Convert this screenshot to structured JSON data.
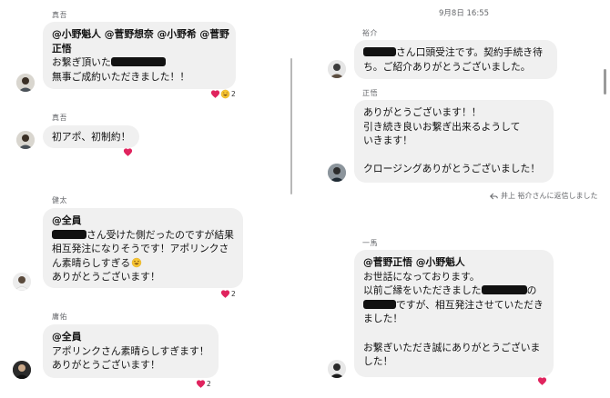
{
  "left": {
    "m1": {
      "sender": "真吾",
      "lines": [
        "@小野魁人 @菅野想奈 @小野希 @菅野",
        "正悟",
        "お繋ぎ頂いた",
        "無事ご成約いただきました！！"
      ],
      "reaction_count": "2",
      "reaction_icons": [
        "heart-icon",
        "grinning-face-icon"
      ]
    },
    "m2": {
      "sender": "真吾",
      "lines": [
        "初アポ、初制約！"
      ],
      "reaction_icons": [
        "heart-icon"
      ]
    },
    "m3": {
      "sender": "健太",
      "lines": [
        "@全員",
        "さん受けた側だったのですが結果",
        "相互発注になりそうです！アポリンクさ",
        "ん素晴らしすぎる",
        "ありがとうございます！"
      ],
      "reaction_count": "2",
      "reaction_icons": [
        "heart-icon"
      ]
    },
    "m4": {
      "sender": "庸佑",
      "lines": [
        "@全員",
        "アポリンクさん素晴らしすぎます！",
        "ありがとうございます！"
      ],
      "reaction_count": "2",
      "reaction_icons": [
        "heart-icon"
      ]
    }
  },
  "right": {
    "timestamp": "9月8日 16:55",
    "m1": {
      "sender": "裕介",
      "lines": [
        "さん口頭受注です。契約手続き待",
        "ち。ご紹介ありがとうございました。"
      ]
    },
    "m2": {
      "sender": "正悟",
      "lines": [
        "ありがとうございます！！",
        "引き続き良いお繋ぎ出来るようして",
        "いきます！",
        "",
        "クロージングありがとうございました！"
      ]
    },
    "replied_note": "井上 裕介さんに返信しました",
    "m3": {
      "sender": "一馬",
      "lines": [
        "@菅野正悟 @小野魁人",
        "お世話になっております。",
        "以前ご縁をいただきました",
        "ですが、相互発注させていただき",
        "ました！",
        "",
        "お繋ぎいただき誠にありがとうございま",
        "した！"
      ],
      "suffix": "の",
      "reaction_icons": [
        "heart-icon"
      ]
    }
  },
  "colors": {
    "bubble": "#f0f0f0",
    "heart": "#e0245e",
    "redaction": "#111111",
    "meta_text": "#65676b"
  }
}
